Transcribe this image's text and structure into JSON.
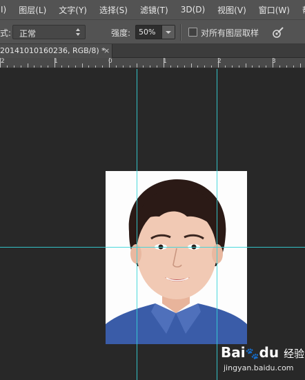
{
  "menubar": {
    "items": [
      {
        "label": "I)"
      },
      {
        "label": "图层(L)"
      },
      {
        "label": "文字(Y)"
      },
      {
        "label": "选择(S)"
      },
      {
        "label": "滤镜(T)"
      },
      {
        "label": "3D(D)"
      },
      {
        "label": "视图(V)"
      },
      {
        "label": "窗口(W)"
      },
      {
        "label": "帮助"
      }
    ]
  },
  "options": {
    "mode_label": "式:",
    "mode_value": "正常",
    "strength_label": "强度:",
    "strength_value": "50%",
    "sample_all_label": "对所有图层取样",
    "sample_all_checked": false
  },
  "document": {
    "tab_title": "20141010160236, RGB/8) *",
    "close_glyph": "×"
  },
  "ruler": {
    "numbers": [
      "2",
      "1",
      "0",
      "1",
      "2",
      "3"
    ]
  },
  "canvas": {
    "background": "#282828",
    "guide_color": "#35d4d8"
  },
  "watermark": {
    "logo_text": "Bai",
    "logo_text_2": "du",
    "logo_suffix": "经验",
    "url": "jingyan.baidu.com"
  }
}
